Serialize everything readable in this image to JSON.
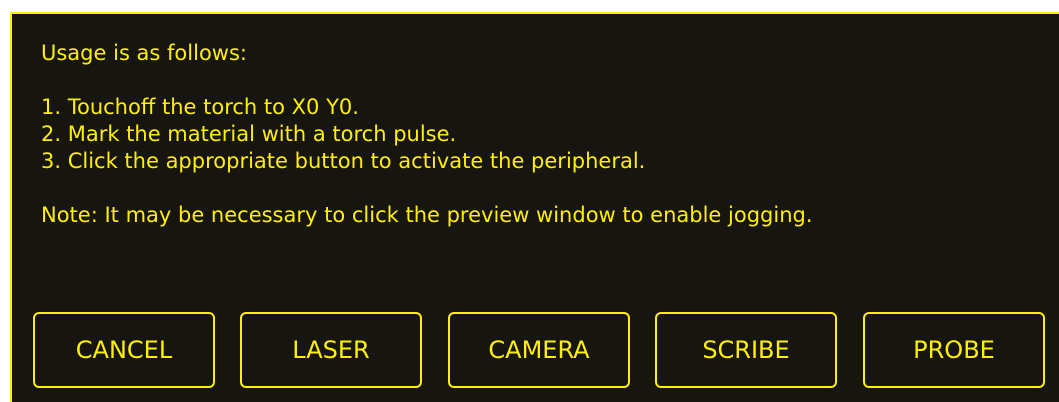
{
  "colors": {
    "background": "#16150f",
    "accent": "#ffee06"
  },
  "message": {
    "heading": "Usage is as follows:",
    "steps": [
      "1. Touchoff the torch to X0 Y0.",
      "2. Mark the material with a torch pulse.",
      "3. Click the appropriate button to activate the peripheral."
    ],
    "note": "Note: It may be necessary to click the preview window to enable jogging."
  },
  "buttons": {
    "cancel": "CANCEL",
    "laser": "LASER",
    "camera": "CAMERA",
    "scribe": "SCRIBE",
    "probe": "PROBE"
  }
}
